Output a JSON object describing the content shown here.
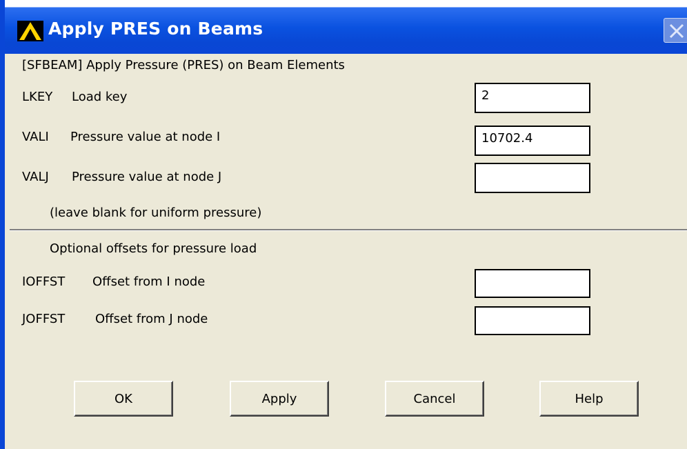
{
  "window": {
    "title": "Apply PRES on Beams"
  },
  "dialog": {
    "command_label": "[SFBEAM]  Apply Pressure (PRES) on Beam Elements",
    "fields": [
      {
        "key": "LKEY",
        "label": "Load key",
        "value": ""
      },
      {
        "key": "VALI",
        "label": "Pressure value at node I",
        "value": "10702.4"
      },
      {
        "key": "VALJ",
        "label": "Pressure value at node J",
        "value": ""
      }
    ],
    "lkey_value": "2",
    "note": "(leave blank for uniform pressure)",
    "offsets_heading": "Optional offsets for pressure load",
    "offsets": [
      {
        "key": "IOFFST",
        "label": "Offset from I node",
        "value": ""
      },
      {
        "key": "JOFFST",
        "label": "Offset from J node",
        "value": ""
      }
    ]
  },
  "buttons": {
    "ok": "OK",
    "apply": "Apply",
    "cancel": "Cancel",
    "help": "Help"
  }
}
